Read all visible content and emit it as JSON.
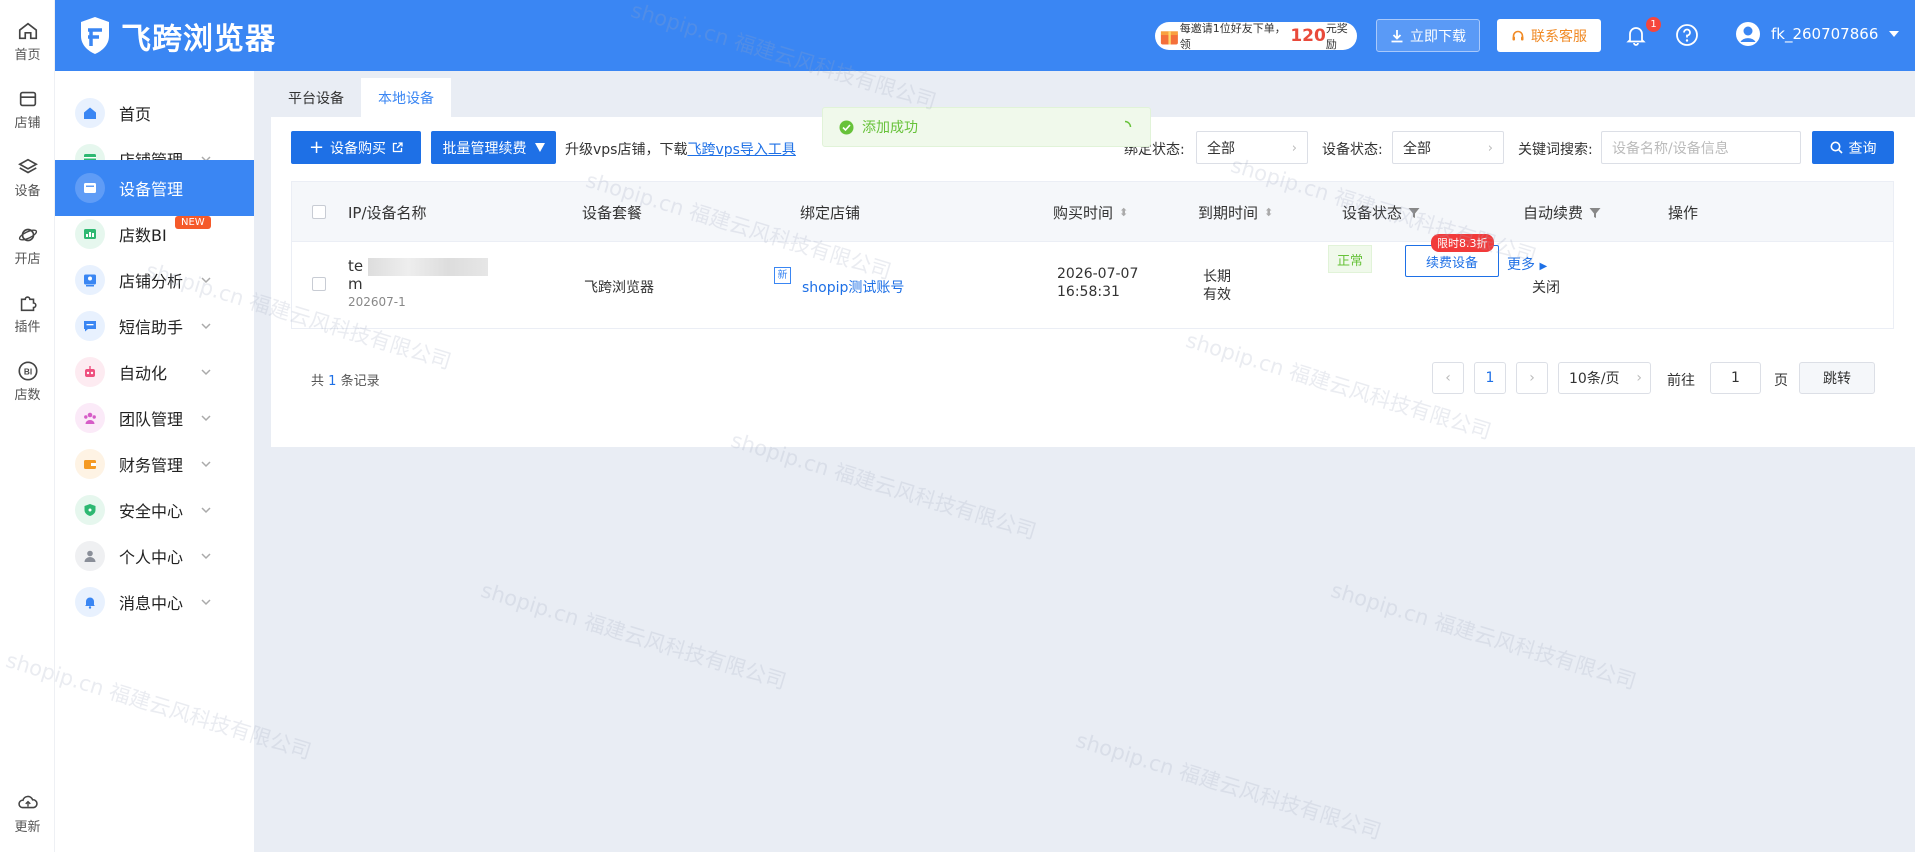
{
  "rail": {
    "items": [
      {
        "label": "首页",
        "icon": "home-outline-icon"
      },
      {
        "label": "店铺",
        "icon": "store-icon"
      },
      {
        "label": "设备",
        "icon": "layers-icon"
      },
      {
        "label": "开店",
        "icon": "planet-icon"
      },
      {
        "label": "插件",
        "icon": "puzzle-icon"
      },
      {
        "label": "店数",
        "icon": "bi-icon"
      }
    ],
    "update_label": "更新"
  },
  "header": {
    "logo_text": "飞跨浏览器",
    "promo": {
      "prefix": "每邀请1位好友下单，领",
      "amount": "120",
      "suffix": "元奖励"
    },
    "download_label": "立即下载",
    "service_label": "联系客服",
    "notification_count": "1",
    "username": "fk_260707866"
  },
  "sidebar": {
    "items": [
      {
        "label": "首页",
        "icon": "home-icon",
        "color": "#3a86f3"
      },
      {
        "label": "店铺管理",
        "icon": "store-icon",
        "color": "#2eb872"
      },
      {
        "label": "设备管理",
        "icon": "device-icon",
        "color": "#3a86f3",
        "active": true
      },
      {
        "label": "店数BI",
        "icon": "bi-icon",
        "color": "#2eb872",
        "badge": "NEW"
      },
      {
        "label": "店铺分析",
        "icon": "analysis-icon",
        "color": "#3a86f3"
      },
      {
        "label": "短信助手",
        "icon": "message-icon",
        "color": "#3a86f3"
      },
      {
        "label": "自动化",
        "icon": "robot-icon",
        "color": "#ee4f7e"
      },
      {
        "label": "团队管理",
        "icon": "team-icon",
        "color": "#d65cc7"
      },
      {
        "label": "财务管理",
        "icon": "wallet-icon",
        "color": "#f59a23"
      },
      {
        "label": "安全中心",
        "icon": "shield-icon",
        "color": "#2eb872"
      },
      {
        "label": "个人中心",
        "icon": "user-icon",
        "color": "#8a8f99"
      },
      {
        "label": "消息中心",
        "icon": "bell-icon",
        "color": "#3a86f3"
      }
    ]
  },
  "tabs": [
    {
      "label": "平台设备",
      "active": false
    },
    {
      "label": "本地设备",
      "active": true
    }
  ],
  "toolbar": {
    "buy_label": "设备购买",
    "batch_label": "批量管理续费",
    "vps_text": "升级vps店铺，下载",
    "vps_link": "飞跨vps导入工具"
  },
  "toast": {
    "message": "添加成功"
  },
  "filters": {
    "bind_status_label": "绑定状态:",
    "bind_status_value": "全部",
    "device_status_label": "设备状态:",
    "device_status_value": "全部",
    "keyword_label": "关键词搜索:",
    "keyword_placeholder": "设备名称/设备信息",
    "query_label": "查询"
  },
  "table": {
    "headers": [
      "IP/设备名称",
      "设备套餐",
      "绑定店铺",
      "购买时间",
      "到期时间",
      "设备状态",
      "自动续费",
      "操作"
    ],
    "rows": [
      {
        "name_start": "te",
        "name_end": "m",
        "new_tag": "新",
        "sub": "202607-1",
        "package": "飞跨浏览器",
        "shop": "shopip测试账号",
        "buy_date": "2026-07-07",
        "buy_time": "16:58:31",
        "expire_1": "长期",
        "expire_2": "有效",
        "status": "正常",
        "auto_renew": "关闭",
        "discount": "限时8.3折",
        "renew_label": "续费设备",
        "more_label": "更多"
      }
    ]
  },
  "pagination": {
    "total_prefix": "共",
    "total_count": "1",
    "total_suffix": "条记录",
    "current_page": "1",
    "page_size": "10条/页",
    "goto_label": "前往",
    "goto_value": "1",
    "page_unit": "页",
    "jump_label": "跳转"
  },
  "watermark": "shopip.cn 福建云风科技有限公司"
}
